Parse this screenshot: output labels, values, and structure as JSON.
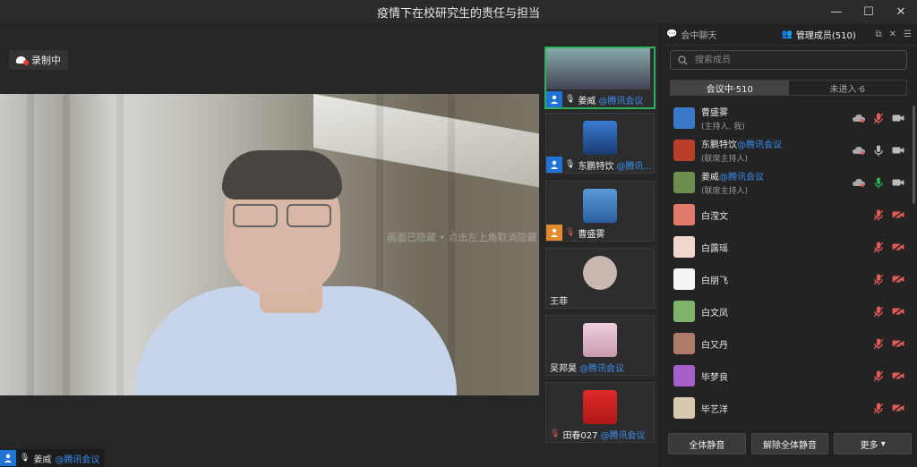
{
  "window": {
    "title": "疫情下在校研究生的责任与担当"
  },
  "recording": {
    "label": "录制中"
  },
  "main_video": {
    "overlay_text": "画面已隐藏 • 点击左上角取消隐藏",
    "speaker_name": "姜威",
    "speaker_suffix": "@腾讯会议"
  },
  "tiles": [
    {
      "name": "姜威",
      "suffix": "@腾讯会议",
      "active": true,
      "badge": "blue"
    },
    {
      "name": "东鹏特饮",
      "suffix": "@腾讯...",
      "active": false,
      "badge": "blue"
    },
    {
      "name": "曹盛雾",
      "suffix": "",
      "active": false,
      "badge": "orange"
    },
    {
      "name": "王菲",
      "suffix": "",
      "active": false,
      "badge": "none"
    },
    {
      "name": "吴邦昊",
      "suffix": "@腾讯会议",
      "active": false,
      "badge": "none"
    },
    {
      "name": "田春027",
      "suffix": "@腾讯会议",
      "active": false,
      "badge": "none"
    }
  ],
  "panel": {
    "tab_chat": "会中聊天",
    "tab_members": "管理成员(510)",
    "search_placeholder": "搜索成员",
    "seg_in": "会议中·510",
    "seg_out": "未进入·6",
    "members": [
      {
        "name": "曹盛雾",
        "suffix": "",
        "role": "(主持人, 我)",
        "color": "#3b79c9"
      },
      {
        "name": "东鹏特饮",
        "suffix": "@腾讯会议",
        "role": "(联席主持人)",
        "color": "#b8402a"
      },
      {
        "name": "姜威",
        "suffix": "@腾讯会议",
        "role": "(联席主持人)",
        "color": "#6b8e4e"
      },
      {
        "name": "白滢文",
        "suffix": "",
        "role": "",
        "color": "#e07a6b"
      },
      {
        "name": "白露瑶",
        "suffix": "",
        "role": "",
        "color": "#f2d6d0"
      },
      {
        "name": "白朋飞",
        "suffix": "",
        "role": "",
        "color": "#f5f5f5"
      },
      {
        "name": "白文凤",
        "suffix": "",
        "role": "",
        "color": "#7fb36a"
      },
      {
        "name": "白又丹",
        "suffix": "",
        "role": "",
        "color": "#b07a6a"
      },
      {
        "name": "毕梦良",
        "suffix": "",
        "role": "",
        "color": "#a55fc9"
      },
      {
        "name": "毕艺洋",
        "suffix": "",
        "role": "",
        "color": "#d8c8b0"
      },
      {
        "name": "",
        "suffix": "",
        "role": "",
        "color": "#4a7fc0"
      }
    ],
    "btn_mute_all": "全体静音",
    "btn_unmute_all": "解除全体静音",
    "btn_more": "更多"
  },
  "colors": {
    "accent": "#1f74d6",
    "active_border": "#2ab35c",
    "link": "#3b8ef0",
    "muted_red": "#e05a5a"
  }
}
